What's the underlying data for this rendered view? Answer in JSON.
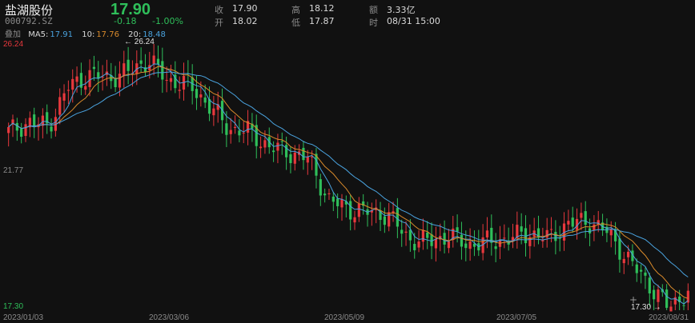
{
  "stock": {
    "name": "盐湖股份",
    "code": "000792.SZ",
    "price": "17.90",
    "change": "-0.18",
    "change_pct": "-1.00%"
  },
  "quote": {
    "close_label": "收",
    "close_value": "17.90",
    "open_label": "开",
    "open_value": "18.02",
    "high_label": "高",
    "high_value": "18.12",
    "low_label": "低",
    "low_value": "17.87",
    "amount_label": "额",
    "amount_value": "3.33亿",
    "time_label": "时",
    "time_value": "08/31 15:00"
  },
  "indicators": {
    "overlay_label": "叠加",
    "ma5_label": "MA5:",
    "ma5_value": "17.91",
    "ma10_label": "10:",
    "ma10_value": "17.76",
    "ma20_label": "20:",
    "ma20_value": "18.48"
  },
  "colors": {
    "up": "#e8383d",
    "down": "#2fbf5a",
    "ma5": "#4aa3df",
    "ma10": "#d98a2b",
    "ma20": "#4aa3df",
    "price_max": "#e8383d",
    "background": "#111111"
  },
  "chart_data": {
    "type": "candlestick",
    "y_ticks": [
      "26.24",
      "21.77",
      "17.30"
    ],
    "ylim": [
      17.3,
      26.24
    ],
    "x_ticks": [
      "2023/01/03",
      "2023/03/06",
      "2023/05/09",
      "2023/07/05",
      "2023/08/31"
    ],
    "max_annotation": "26.24",
    "min_annotation": "17.30",
    "anchors": [
      {
        "date": "2023/01/03",
        "close": 23.3
      },
      {
        "date": "2023/01/10",
        "close": 23.6
      },
      {
        "date": "2023/01/17",
        "close": 23.5
      },
      {
        "date": "2023/01/31",
        "close": 24.8
      },
      {
        "date": "2023/02/07",
        "close": 25.2
      },
      {
        "date": "2023/02/14",
        "close": 25.1
      },
      {
        "date": "2023/02/21",
        "close": 25.3
      },
      {
        "date": "2023/02/28",
        "close": 25.7
      },
      {
        "date": "2023/03/06",
        "close": 25.0
      },
      {
        "date": "2023/03/13",
        "close": 24.9
      },
      {
        "date": "2023/03/20",
        "close": 24.2
      },
      {
        "date": "2023/03/27",
        "close": 23.4
      },
      {
        "date": "2023/04/03",
        "close": 23.3
      },
      {
        "date": "2023/04/10",
        "close": 22.8
      },
      {
        "date": "2023/04/17",
        "close": 22.6
      },
      {
        "date": "2023/04/24",
        "close": 22.4
      },
      {
        "date": "2023/05/04",
        "close": 21.0
      },
      {
        "date": "2023/05/09",
        "close": 20.7
      },
      {
        "date": "2023/05/16",
        "close": 20.6
      },
      {
        "date": "2023/05/23",
        "close": 20.5
      },
      {
        "date": "2023/05/30",
        "close": 19.7
      },
      {
        "date": "2023/06/06",
        "close": 19.6
      },
      {
        "date": "2023/06/13",
        "close": 19.8
      },
      {
        "date": "2023/06/20",
        "close": 19.5
      },
      {
        "date": "2023/06/28",
        "close": 19.6
      },
      {
        "date": "2023/07/05",
        "close": 19.7
      },
      {
        "date": "2023/07/12",
        "close": 19.9
      },
      {
        "date": "2023/07/19",
        "close": 19.7
      },
      {
        "date": "2023/07/26",
        "close": 20.2
      },
      {
        "date": "2023/08/02",
        "close": 20.3
      },
      {
        "date": "2023/08/09",
        "close": 19.9
      },
      {
        "date": "2023/08/16",
        "close": 19.0
      },
      {
        "date": "2023/08/23",
        "close": 18.2
      },
      {
        "date": "2023/08/28",
        "close": 17.4
      },
      {
        "date": "2023/08/31",
        "close": 17.9
      }
    ],
    "grid": false
  }
}
